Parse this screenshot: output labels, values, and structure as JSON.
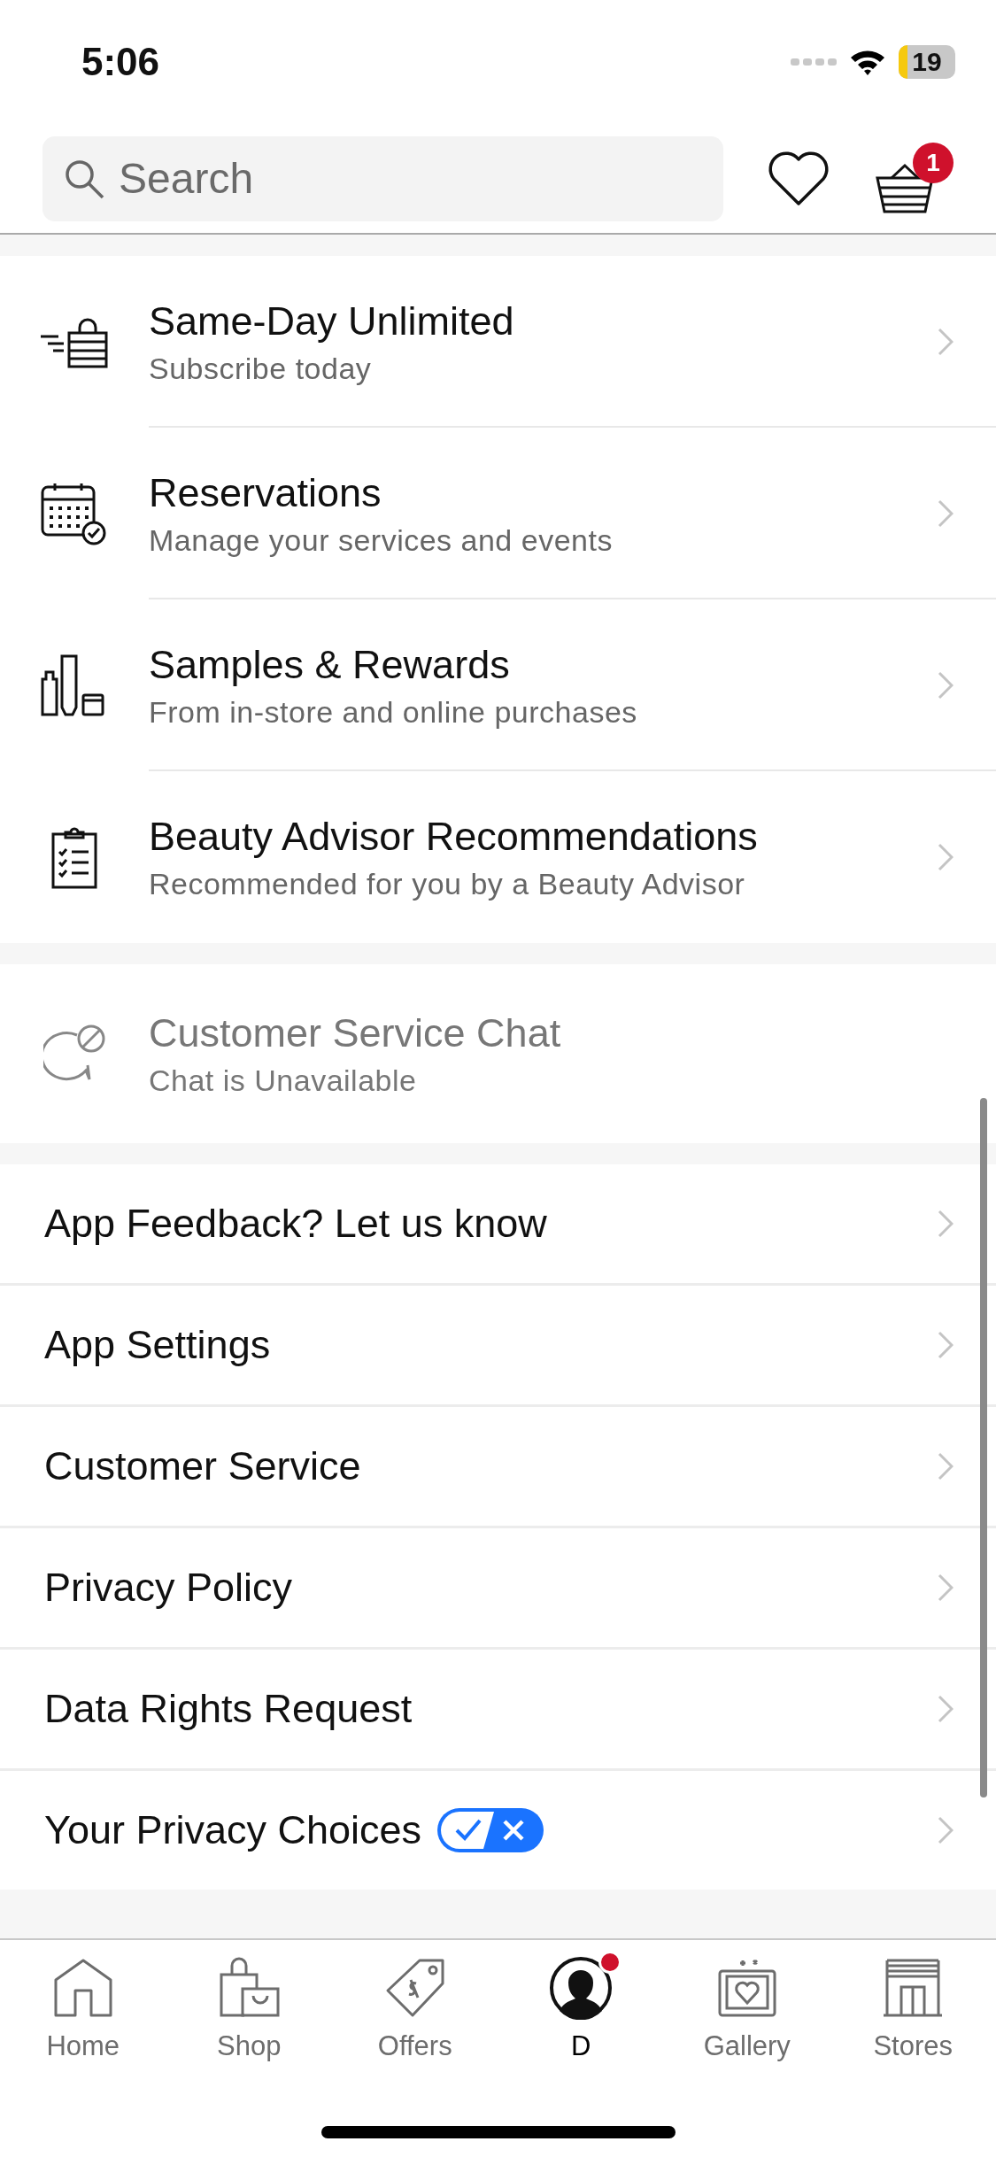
{
  "status_bar": {
    "time": "5:06",
    "battery": "19"
  },
  "header": {
    "search": {
      "placeholder": "Search"
    },
    "cart_count": "1"
  },
  "feature_items": [
    {
      "kind": "delivery",
      "title": "Same-Day Unlimited",
      "subtitle": "Subscribe today",
      "disabled": false
    },
    {
      "kind": "calendar",
      "title": "Reservations",
      "subtitle": "Manage your services and events",
      "disabled": false
    },
    {
      "kind": "samples",
      "title": "Samples & Rewards",
      "subtitle": "From in-store and online purchases",
      "disabled": false
    },
    {
      "kind": "clipboard",
      "title": "Beauty Advisor Recommendations",
      "subtitle": "Recommended for you by a Beauty Advisor",
      "disabled": false
    }
  ],
  "chat": {
    "title": "Customer Service Chat",
    "subtitle": "Chat is Unavailable",
    "disabled": true
  },
  "links": [
    {
      "label": "App Feedback? Let us know",
      "kind": "plain"
    },
    {
      "label": "App Settings",
      "kind": "plain"
    },
    {
      "label": "Customer Service",
      "kind": "plain"
    },
    {
      "label": "Privacy Policy",
      "kind": "plain"
    },
    {
      "label": "Data Rights Request",
      "kind": "plain"
    },
    {
      "label": "Your Privacy Choices",
      "kind": "privacy"
    }
  ],
  "tab_bar": [
    {
      "kind": "home",
      "label": "Home",
      "selected": false,
      "badge": false
    },
    {
      "kind": "shop",
      "label": "Shop",
      "selected": false,
      "badge": false
    },
    {
      "kind": "offers",
      "label": "Offers",
      "selected": false,
      "badge": false
    },
    {
      "kind": "profile",
      "label": "D",
      "selected": true,
      "badge": true
    },
    {
      "kind": "gallery",
      "label": "Gallery",
      "selected": false,
      "badge": false
    },
    {
      "kind": "stores",
      "label": "Stores",
      "selected": false,
      "badge": false
    }
  ]
}
